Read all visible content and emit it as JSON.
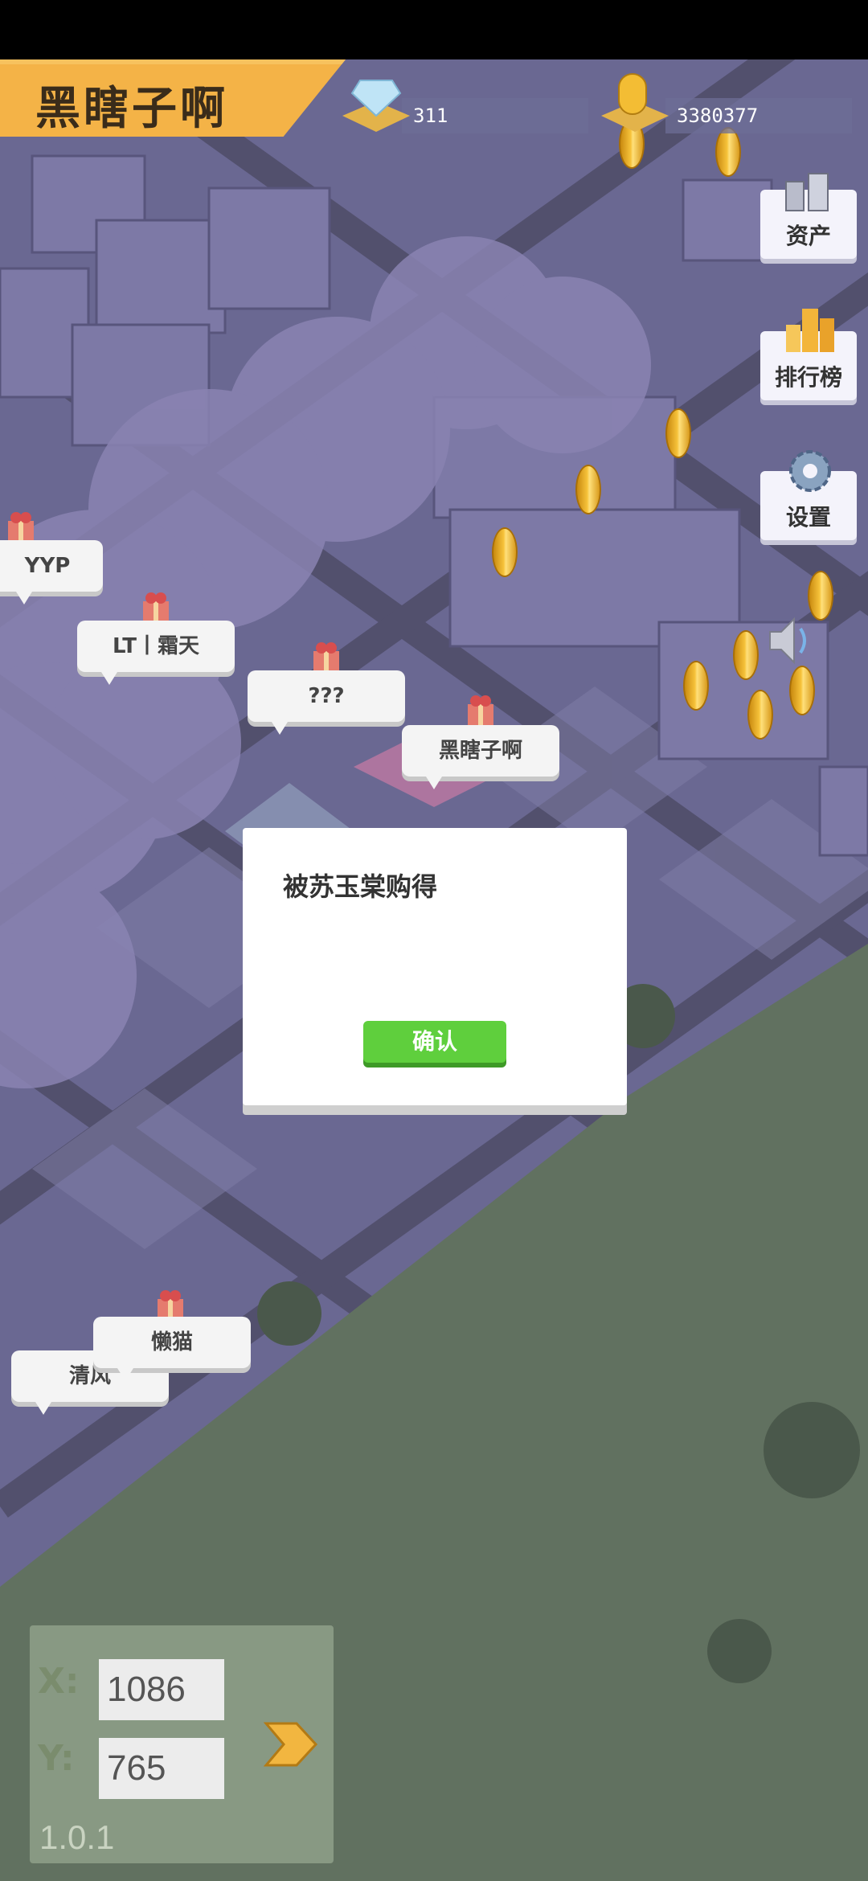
{
  "player": {
    "name": "黑瞎子啊"
  },
  "resources": {
    "diamonds": "311",
    "coins": "3380377"
  },
  "side_menu": [
    {
      "label": "资产",
      "icon": "assets-icon"
    },
    {
      "label": "排行榜",
      "icon": "leaderboard-icon"
    },
    {
      "label": "设置",
      "icon": "gear-icon"
    }
  ],
  "bubbles": [
    {
      "label": "YYP"
    },
    {
      "label": "LT丨霜天"
    },
    {
      "label": "???"
    },
    {
      "label": "黑瞎子啊"
    },
    {
      "label": "懒猫"
    },
    {
      "label": "清风"
    }
  ],
  "dialog": {
    "message": "被苏玉棠购得",
    "confirm_label": "确认"
  },
  "coords": {
    "x_label": "X:",
    "y_label": "Y:",
    "x_value": "1086",
    "y_value": "765"
  },
  "version": "1.0.1",
  "colors": {
    "accent": "#f4b347",
    "confirm": "#5fcf3d",
    "grass": "#6b7f63",
    "city": "#7a77a8"
  }
}
